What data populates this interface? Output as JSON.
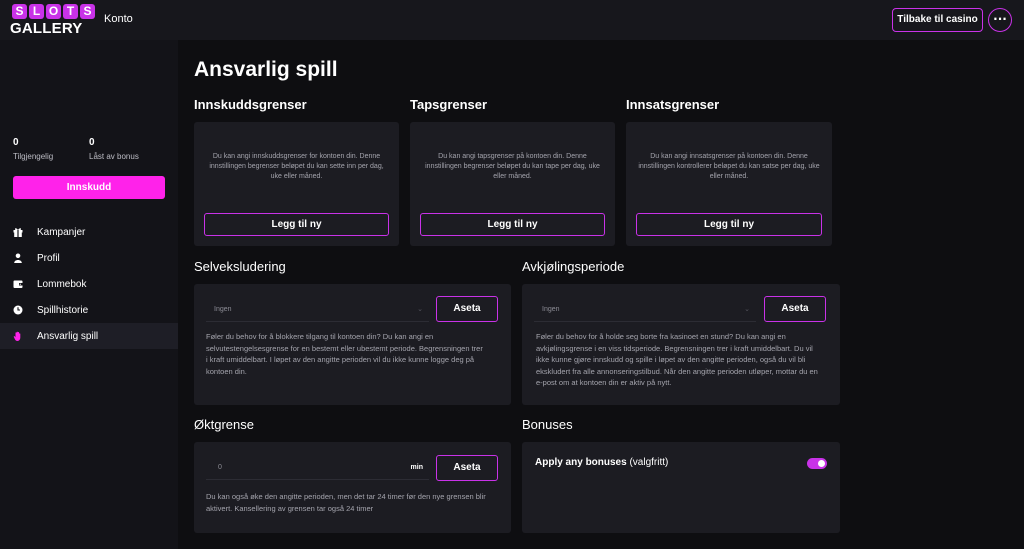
{
  "header": {
    "logo_top": [
      "S",
      "L",
      "O",
      "T",
      "S"
    ],
    "logo_bottom": "GALLERY",
    "title": "Konto",
    "back_button": "Tilbake til casino",
    "more_icon": "more-horizontal-icon"
  },
  "sidebar": {
    "balances": [
      {
        "value": "0",
        "label": "Tilgjengelig"
      },
      {
        "value": "0",
        "label": "Låst av bonus"
      }
    ],
    "deposit_button": "Innskudd",
    "items": [
      {
        "label": "Kampanjer",
        "icon": "gift-icon"
      },
      {
        "label": "Profil",
        "icon": "user-icon"
      },
      {
        "label": "Lommebok",
        "icon": "wallet-icon"
      },
      {
        "label": "Spillhistorie",
        "icon": "clock-icon"
      },
      {
        "label": "Ansvarlig spill",
        "icon": "hand-icon",
        "active": true
      }
    ]
  },
  "main": {
    "title": "Ansvarlig spill",
    "limits": [
      {
        "title": "Innskuddsgrenser",
        "description": "Du kan angi innskuddsgrenser for kontoen din. Denne innstillingen begrenser beløpet du kan sette inn per dag, uke eller måned.",
        "button": "Legg til ny"
      },
      {
        "title": "Tapsgrenser",
        "description": "Du kan angi tapsgrenser på kontoen din. Denne innstillingen begrenser beløpet du kan tape per dag, uke eller måned.",
        "button": "Legg til ny"
      },
      {
        "title": "Innsatsgrenser",
        "description": "Du kan angi innsatsgrenser på kontoen din. Denne innstillingen kontrollerer beløpet du kan satse per dag, uke eller måned.",
        "button": "Legg til ny"
      }
    ],
    "self_exclusion": {
      "title": "Selveksludering",
      "select_value": "Ingen",
      "button": "Aseta",
      "text": "Føler du behov for å blokkere tilgang til kontoen din? Du kan angi en selvutestengelsesgrense for en bestemt eller ubestemt periode. Begrensningen trer i kraft umiddelbart. I løpet av den angitte perioden vil du ikke kunne logge deg på kontoen din."
    },
    "cooling": {
      "title": "Avkjølingsperiode",
      "select_value": "Ingen",
      "button": "Aseta",
      "text": "Føler du behov for å holde seg borte fra kasinoet en stund? Du kan angi en avkjølingsgrense i en viss tidsperiode. Begrensningen trer i kraft umiddelbart. Du vil ikke kunne gjøre innskudd og spille i løpet av den angitte perioden, også du vil bli ekskludert fra alle annonseringstilbud. Når den angitte perioden utløper, mottar du en e-post om at kontoen din er aktiv på nytt."
    },
    "session": {
      "title": "Øktgrense",
      "input_value": "0",
      "unit": "min",
      "button": "Aseta",
      "text": "Du kan også øke den angitte perioden, men det tar 24 timer før den nye grensen blir aktivert. Kansellering av grensen tar også 24 timer"
    },
    "bonuses": {
      "title": "Bonuses",
      "label": "Apply any bonuses",
      "optional": "(valgfritt)",
      "enabled": true
    }
  },
  "colors": {
    "accent": "#c932e8",
    "deposit": "#ff22ea",
    "card": "#1c1c22",
    "background": "#0e0e11"
  }
}
